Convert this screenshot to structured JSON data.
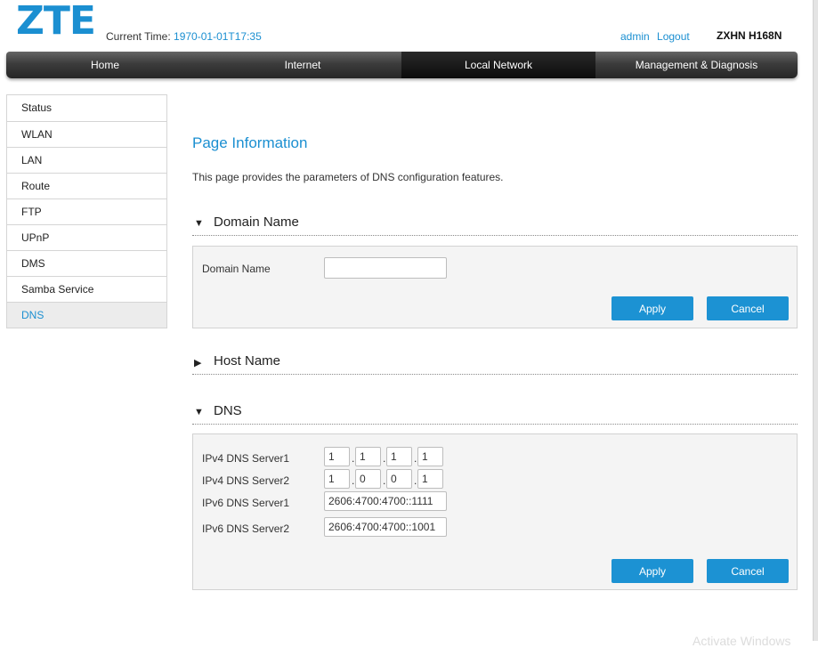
{
  "header": {
    "logo_text": "ZTE",
    "current_time_label": "Current Time:",
    "current_time_value": "1970-01-01T17:35",
    "user": "admin",
    "logout": "Logout",
    "model": "ZXHN H168N"
  },
  "topnav": [
    {
      "label": "Home",
      "active": false
    },
    {
      "label": "Internet",
      "active": false
    },
    {
      "label": "Local Network",
      "active": true
    },
    {
      "label": "Management & Diagnosis",
      "active": false
    }
  ],
  "sidebar": {
    "items": [
      {
        "label": "Status"
      },
      {
        "label": "WLAN"
      },
      {
        "label": "LAN"
      },
      {
        "label": "Route"
      },
      {
        "label": "FTP"
      },
      {
        "label": "UPnP"
      },
      {
        "label": "DMS"
      },
      {
        "label": "Samba Service"
      },
      {
        "label": "DNS",
        "active": true
      }
    ]
  },
  "page": {
    "title": "Page Information",
    "description": "This page provides the parameters of DNS configuration features."
  },
  "domain_section": {
    "title": "Domain Name",
    "expanded": true,
    "arrow_icon": "triangle-down-icon",
    "field_label": "Domain Name",
    "field_value": "",
    "apply_label": "Apply",
    "cancel_label": "Cancel"
  },
  "host_section": {
    "title": "Host Name",
    "expanded": false,
    "arrow_icon": "triangle-right-icon"
  },
  "dns_section": {
    "title": "DNS",
    "expanded": true,
    "arrow_icon": "triangle-down-icon",
    "ipv4_server1_label": "IPv4 DNS Server1",
    "ipv4_server1": [
      "1",
      "1",
      "1",
      "1"
    ],
    "ipv4_server2_label": "IPv4 DNS Server2",
    "ipv4_server2": [
      "1",
      "0",
      "0",
      "1"
    ],
    "ipv6_server1_label": "IPv6 DNS Server1",
    "ipv6_server1": "2606:4700:4700::1111",
    "ipv6_server2_label": "IPv6 DNS Server2",
    "ipv6_server2": "2606:4700:4700::1001",
    "apply_label": "Apply",
    "cancel_label": "Cancel"
  },
  "watermark": "Activate Windows",
  "colors": {
    "accent": "#1b8fd1",
    "button": "#1c92d3",
    "nav_dark": "#262626",
    "panel_bg": "#f4f4f4"
  }
}
